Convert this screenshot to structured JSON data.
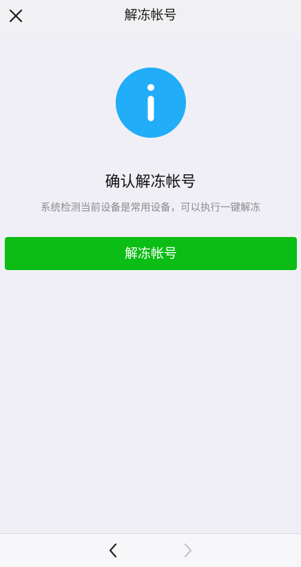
{
  "header": {
    "title": "解冻帐号",
    "close_icon": "close-icon"
  },
  "main": {
    "icon": "info-icon",
    "icon_color": "#21adf7",
    "title": "确认解冻帐号",
    "description": "系统检测当前设备是常用设备，可以执行一键解冻",
    "button_label": "解冻帐号",
    "button_color": "#0bbd14"
  },
  "bottom_nav": {
    "back_icon": "chevron-left-icon",
    "forward_icon": "chevron-right-icon",
    "forward_enabled": false
  }
}
